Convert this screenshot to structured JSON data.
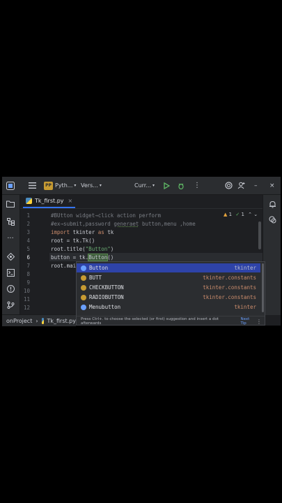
{
  "titlebar": {
    "project_badge": "PP",
    "project_name": "Pyth...",
    "vcs": "Vers...",
    "run_config": "Curr..."
  },
  "tab": {
    "label": "Tk_first.py",
    "close": "×"
  },
  "inspections": {
    "warnings": "1",
    "ok": "1"
  },
  "line_numbers": [
    "1",
    "2",
    "3",
    "4",
    "5",
    "6",
    "7",
    "8",
    "9",
    "10",
    "11",
    "12"
  ],
  "code": {
    "line1": "#BUtton widget→click action perform",
    "line2_a": "#ex→submit,password ",
    "line2_b": "generaet",
    "line2_c": " button,menu ,home",
    "line3_kw1": "import",
    "line3_mid": " tkinter ",
    "line3_kw2": "as",
    "line3_end": " tk",
    "line4": "root = tk.Tk()",
    "line5_a": "root.title(",
    "line5_str": "\"Button\"",
    "line5_b": ")",
    "line6_a": "button = tk.",
    "line6_hl": "Button",
    "line6_b": "()",
    "line7": "root.mai"
  },
  "autocomplete": {
    "items": [
      {
        "name": "Button",
        "module": "tkinter"
      },
      {
        "name": "BUTT",
        "module": "tkinter.constants"
      },
      {
        "name": "CHECKBUTTON",
        "module": "tkinter.constants"
      },
      {
        "name": "RADIOBUTTON",
        "module": "tkinter.constants"
      },
      {
        "name": "Menubutton",
        "module": "tkinter"
      }
    ],
    "hint": "Press Ctrl+. to choose the selected (or first) suggestion and insert a dot afterwards",
    "next_tip": "Next Tip"
  },
  "status": {
    "project": "onProject",
    "file": "Tk_first.py"
  },
  "colors": {
    "accent": "#3574f0",
    "selection": "#2e43a8",
    "background": "#1e1f22"
  }
}
